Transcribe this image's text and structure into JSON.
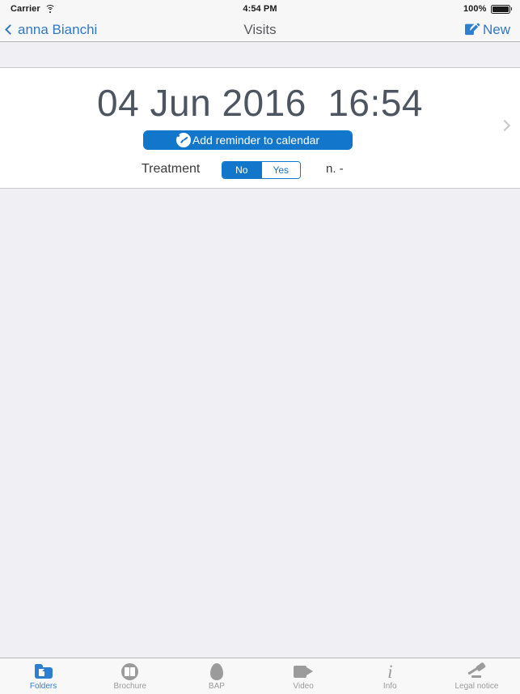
{
  "status_bar": {
    "carrier": "Carrier",
    "wifi_icon": "wifi-icon",
    "time": "4:54 PM",
    "battery_percent": "100%",
    "battery_icon": "battery-full-icon"
  },
  "nav_bar": {
    "back_label": "anna Bianchi",
    "back_icon": "chevron-left-icon",
    "title": "Visits",
    "new_label": "New",
    "new_icon": "compose-icon",
    "tint_color": "#3079c4"
  },
  "visit": {
    "datetime": "04 Jun 2016  16:54",
    "date": "04 Jun 2016",
    "time": "16:54",
    "reminder_button_label": "Add reminder to calendar",
    "reminder_button_icon": "clock-icon",
    "reminder_button_color": "#1277ca",
    "treatment_label": "Treatment",
    "treatment_options": [
      "No",
      "Yes"
    ],
    "treatment_selected": "No",
    "count_label": "n. -",
    "disclosure_icon": "chevron-right-icon"
  },
  "tab_bar": {
    "active_color": "#2f7fd0",
    "inactive_color": "#9b9b9b",
    "items": [
      {
        "label": "Folders",
        "icon": "folder-icon",
        "active": true
      },
      {
        "label": "Brochure",
        "icon": "book-icon",
        "active": false
      },
      {
        "label": "BAP",
        "icon": "egg-icon",
        "active": false
      },
      {
        "label": "Video",
        "icon": "video-icon",
        "active": false
      },
      {
        "label": "Info",
        "icon": "info-icon",
        "active": false
      },
      {
        "label": "Legal notice",
        "icon": "gavel-icon",
        "active": false
      }
    ]
  }
}
